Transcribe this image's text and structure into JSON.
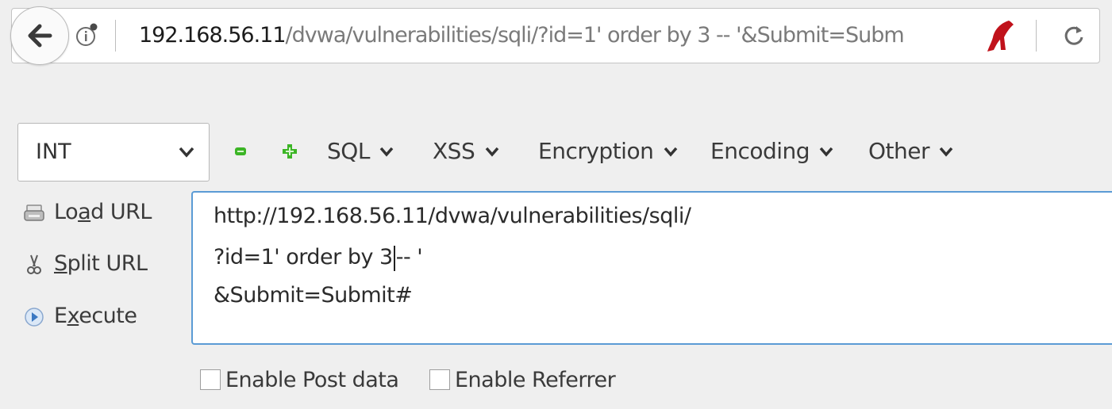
{
  "address_bar": {
    "host": "192.168.56.11",
    "path": "/dvwa/vulnerabilities/sqli/?id=1' order by 3 -- '&Submit=Subm",
    "icons": {
      "back": "back-arrow-icon",
      "identity": "site-info-icon",
      "hackbar": "hackbar-logo-icon",
      "reload": "reload-icon"
    }
  },
  "toolbar": {
    "type_select_value": "INT",
    "minus_icon": "minus-icon",
    "plus_icon": "plus-icon",
    "menus": [
      "SQL",
      "XSS",
      "Encryption",
      "Encoding",
      "Other"
    ]
  },
  "actions": {
    "load_url": {
      "pre": "Lo",
      "key": "a",
      "post": "d URL",
      "icon": "load-url-icon"
    },
    "split_url": {
      "pre": "",
      "key": "S",
      "post": "plit URL",
      "icon": "scissors-icon"
    },
    "execute": {
      "pre": "E",
      "key": "x",
      "post": "ecute",
      "icon": "execute-icon"
    }
  },
  "url_editor": {
    "line1": "http://192.168.56.11/dvwa/vulnerabilities/sqli/",
    "line2_before_caret": "?id=1' order by 3",
    "line2_after_caret": "-- '",
    "line3": "&Submit=Submit#"
  },
  "options": {
    "enable_post_data": {
      "label": "Enable Post data",
      "checked": false
    },
    "enable_referrer": {
      "label": "Enable Referrer",
      "checked": false
    }
  },
  "colors": {
    "focus_border": "#5b9bd5",
    "hackbar_red": "#c0121b",
    "minus_green": "#3cb526",
    "plus_green": "#3cb526"
  }
}
